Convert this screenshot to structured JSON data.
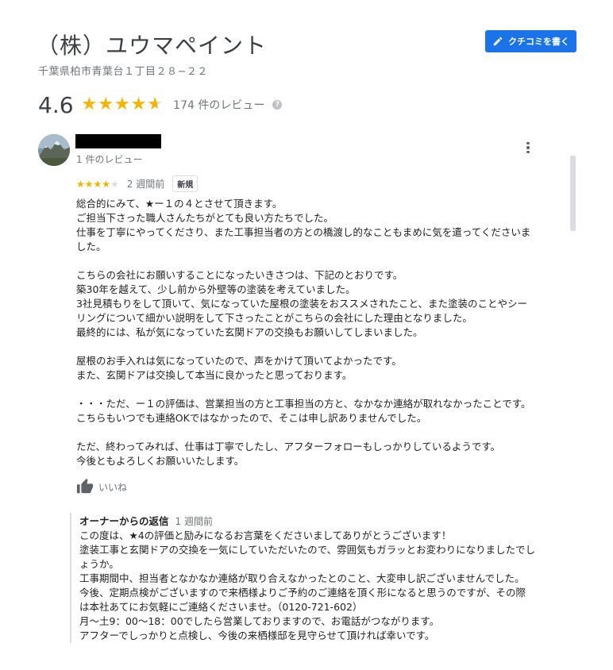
{
  "business": {
    "name": "（株）ユウマペイント",
    "address": "千葉県柏市青葉台１丁目２８−２２",
    "write_review_label": "クチコミを書く",
    "rating_value": "4.6",
    "rating_fraction": 0.92,
    "review_count_label": "174 件のレビュー",
    "help_icon": "?"
  },
  "review": {
    "author_meta": "1 件のレビュー",
    "rating_fraction": 0.8,
    "date": "2 週間前",
    "badge": "新規",
    "body_lines": [
      "総合的にみて、★ー１の４とさせて頂きます。",
      "ご担当下さった職人さんたちがとても良い方たちでした。",
      "仕事を丁寧にやってくださり、また工事担当者の方との橋渡し的なこともまめに気を遣ってくださいま",
      "した。",
      "",
      "こちらの会社にお願いすることになったいきさつは、下記のとおりです。",
      "築30年を越えて、少し前から外壁等の塗装を考えていました。",
      "3社見積もりをして頂いて、気になっていた屋根の塗装をおススメされたこと、また塗装のことやシー",
      "リングについて細かい説明をして下さったことがこちらの会社にした理由となりました。",
      "最終的には、私が気になっていた玄関ドアの交換もお願いしてしまいました。",
      "",
      "屋根のお手入れは気になっていたので、声をかけて頂いてよかったです。",
      "また、玄関ドアは交換して本当に良かったと思っております。",
      "",
      "・・・ただ、ー１の評価は、営業担当の方と工事担当の方と、なかなか連絡が取れなかったことです。",
      "こちらもいつでも連絡OKではなかったので、そこは申し訳ありませんでした。",
      "",
      "ただ、終わってみれば、仕事は丁寧でしたし、アフターフォローもしっかりしているようです。",
      "今後ともよろしくお願いいたします。"
    ],
    "like_label": "いいね"
  },
  "owner_reply": {
    "label": "オーナーからの返信",
    "date": "1 週間前",
    "body_lines": [
      "この度は、★4の評価と励みになるお言葉をくださいましてありがとうございます！",
      "塗装工事と玄関ドアの交換を一気にしていただいたので、雰囲気もガラッとお変わりになりましたでし",
      "ょうか。",
      "工事期間中、担当者となかなか連絡が取り合えなかったとのこと、大変申し訳ございませんでした。",
      "今後、定期点検がございますので来栖様よりご予約のご連絡を頂く形になると思うのですが、その際",
      "は本社あてにお気軽にご連絡くださいませ。（0120-721-602）",
      "月〜土9：00〜18：00でしたら営業しておりますので、お電話がつながります。",
      "アフターでしっかりと点検し、今後の来栖様邸を見守らせて頂ければ幸いです。"
    ]
  },
  "colors": {
    "star": "#f4b400",
    "star_empty": "#dadce0",
    "button": "#1a73e8"
  }
}
